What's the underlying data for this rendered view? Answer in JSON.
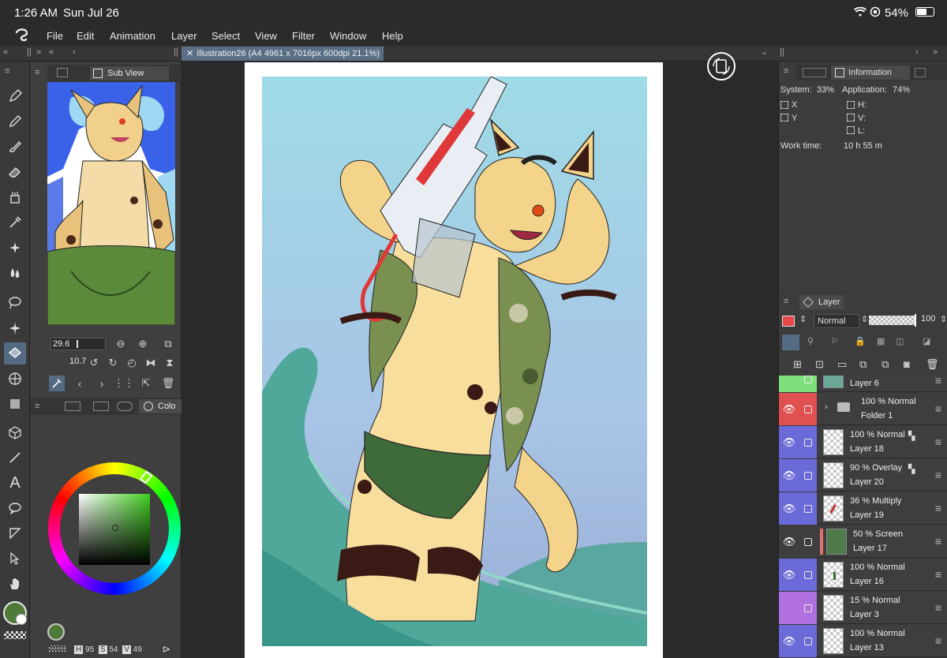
{
  "status": {
    "time": "1:26 AM",
    "date": "Sun Jul 26",
    "battery": "54%"
  },
  "menu": [
    "File",
    "Edit",
    "Animation",
    "Layer",
    "Select",
    "View",
    "Filter",
    "Window",
    "Help"
  ],
  "document_tab": {
    "title": "Illustration26 (A4 4961 x 7016px 600dpi 21.1%)"
  },
  "sub_view": {
    "title": "Sub View",
    "zoom": "29.6",
    "rotation": "10.7"
  },
  "color_panel": {
    "tab": "Colo",
    "h": "95",
    "s": "54",
    "v": "49",
    "h_label": "H",
    "s_label": "S",
    "v_label": "V",
    "main_color": "#4f7a3a"
  },
  "info": {
    "title": "Information",
    "system_label": "System:",
    "system_value": "33%",
    "app_label": "Application:",
    "app_value": "74%",
    "x_label": "X",
    "y_label": "Y",
    "h_label": "H:",
    "v_label": "V:",
    "l_label": "L:",
    "worktime_label": "Work time:",
    "worktime_value": "10 h 55 m"
  },
  "layer_panel": {
    "title": "Layer",
    "blend_mode": "Normal",
    "opacity": "100",
    "layers": [
      {
        "top": "",
        "name": "Layer 6",
        "color": "#7de07d",
        "eye": false,
        "type": "layer"
      },
      {
        "top": "100 % Normal",
        "name": "Folder 1",
        "color": "#e05050",
        "eye": true,
        "type": "folder"
      },
      {
        "top": "100 % Normal",
        "name": "Layer 18",
        "color": "#6a6ad8",
        "eye": true,
        "type": "layer"
      },
      {
        "top": "90 % Overlay",
        "name": "Layer 20",
        "color": "#6a6ad8",
        "eye": true,
        "type": "layer"
      },
      {
        "top": "36 % Multiply",
        "name": "Layer 19",
        "color": "#6a6ad8",
        "eye": true,
        "type": "layer"
      },
      {
        "top": "50 % Screen",
        "name": "Layer 17",
        "color": "",
        "eye": true,
        "type": "fill"
      },
      {
        "top": "100 % Normal",
        "name": "Layer 16",
        "color": "#6a6ad8",
        "eye": true,
        "type": "layer"
      },
      {
        "top": "15 % Normal",
        "name": "Layer 3",
        "color": "#b070e0",
        "eye": true,
        "type": "layer"
      },
      {
        "top": "100 % Normal",
        "name": "Layer 13",
        "color": "#6a6ad8",
        "eye": true,
        "type": "layer"
      }
    ]
  }
}
